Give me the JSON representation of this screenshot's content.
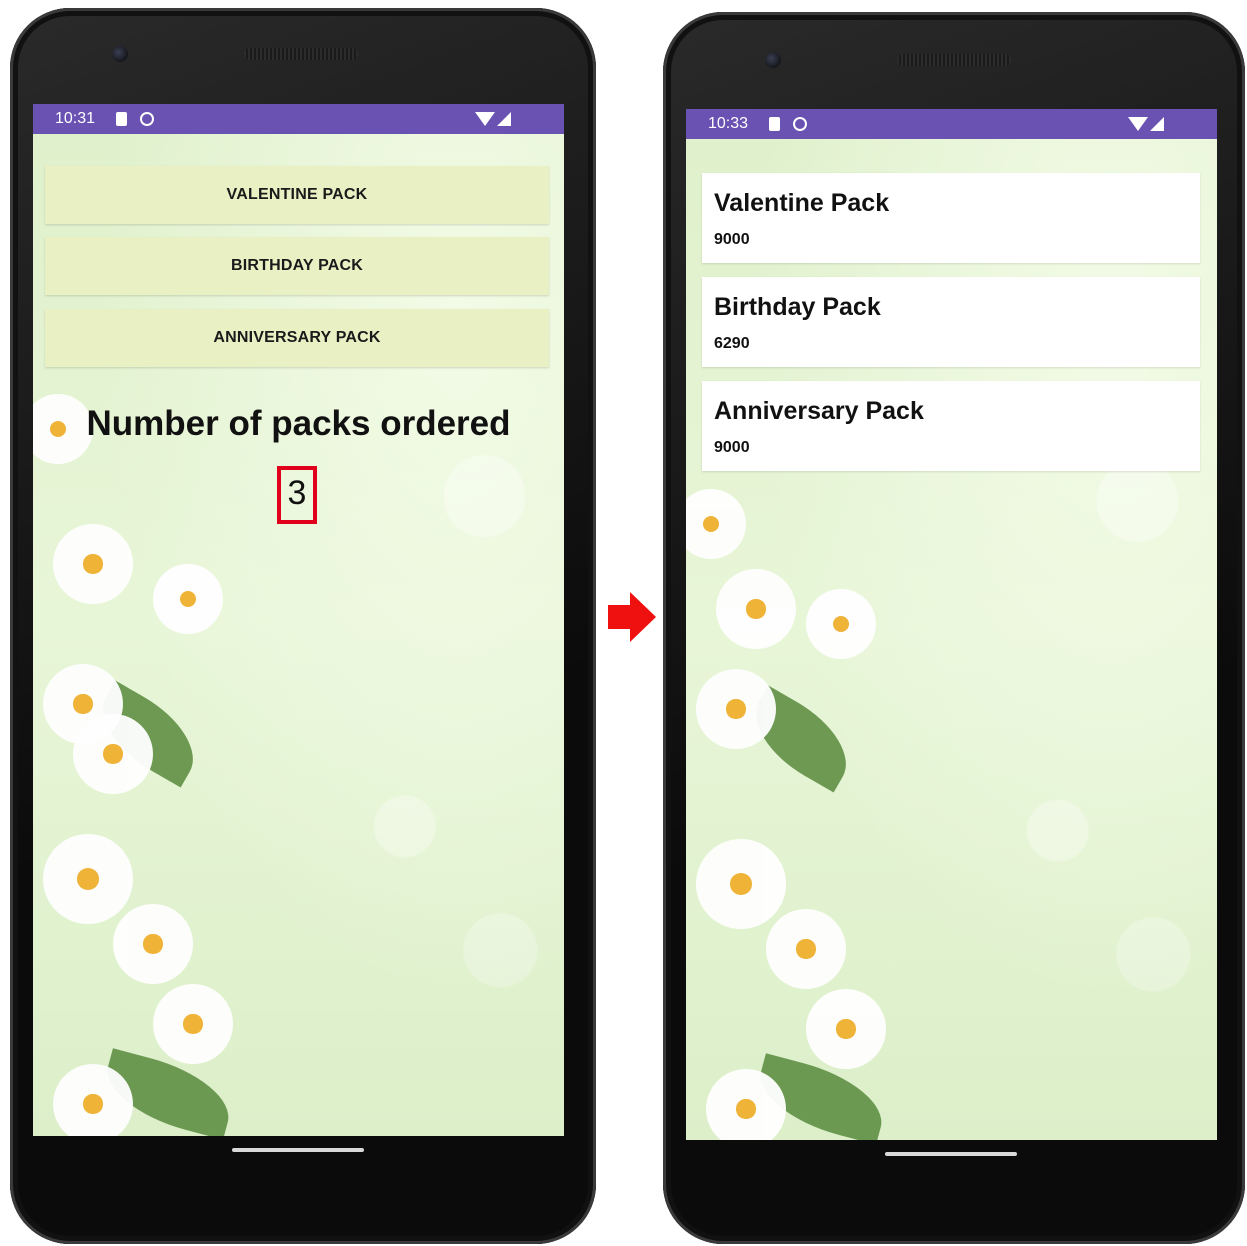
{
  "left_screen": {
    "status": {
      "time": "10:31"
    },
    "buttons": [
      "VALENTINE PACK",
      "BIRTHDAY PACK",
      "ANNIVERSARY PACK"
    ],
    "heading": "Number of packs ordered",
    "count": "3"
  },
  "right_screen": {
    "status": {
      "time": "10:33"
    },
    "packs": [
      {
        "name": "Valentine Pack",
        "price": "9000"
      },
      {
        "name": "Birthday Pack",
        "price": "6290"
      },
      {
        "name": "Anniversary Pack",
        "price": "9000"
      }
    ]
  },
  "colors": {
    "status_bar": "#6a52b3",
    "button_bg": "#e9f0c4",
    "highlight_box": "#e0001b",
    "arrow": "#ef1010"
  }
}
